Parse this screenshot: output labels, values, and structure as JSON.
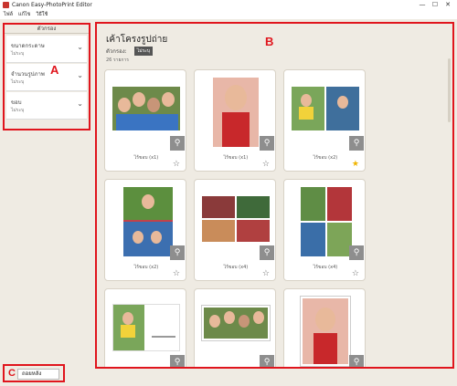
{
  "titlebar": {
    "title": "Canon Easy-PhotoPrint Editor",
    "minimize": "—",
    "maximize": "☐",
    "close": "✕"
  },
  "menu": [
    "ไฟล์",
    "แก้ไข",
    "วิธีใช้"
  ],
  "filter_panel": {
    "header": "ตัวกรอง",
    "sections": [
      {
        "label": "ขนาดกระดาษ",
        "value": "ไม่ระบุ"
      },
      {
        "label": "จำนวนรูปภาพ",
        "value": "ไม่ระบุ"
      },
      {
        "label": "ขอบ",
        "value": "ไม่ระบุ"
      }
    ]
  },
  "markers": {
    "a": "A",
    "b": "B",
    "c": "C"
  },
  "main": {
    "title": "เค้าโครงรูปถ่าย",
    "filter_label": "ตัวกรอง:",
    "filter_tag": "ไม่ระบุ",
    "count": "26 รายการ"
  },
  "back_button": "ถอยหลัง",
  "cards": [
    {
      "caption": "ไร้ขอบ (x1)",
      "favorite": false
    },
    {
      "caption": "ไร้ขอบ (x1)",
      "favorite": false
    },
    {
      "caption": "ไร้ขอบ (x2)",
      "favorite": true
    },
    {
      "caption": "ไร้ขอบ (x2)",
      "favorite": false
    },
    {
      "caption": "ไร้ขอบ (x4)",
      "favorite": false
    },
    {
      "caption": "ไร้ขอบ (x4)",
      "favorite": false
    },
    {
      "caption": "",
      "favorite": false
    },
    {
      "caption": "",
      "favorite": false
    },
    {
      "caption": "",
      "favorite": false
    }
  ],
  "colors": {
    "highlight": "#e0151d",
    "star_on": "#f0b400",
    "background": "#efebe3"
  },
  "icons": {
    "zoom": "magnifier-icon",
    "star": "star-icon",
    "chevron": "chevron-down-icon"
  }
}
